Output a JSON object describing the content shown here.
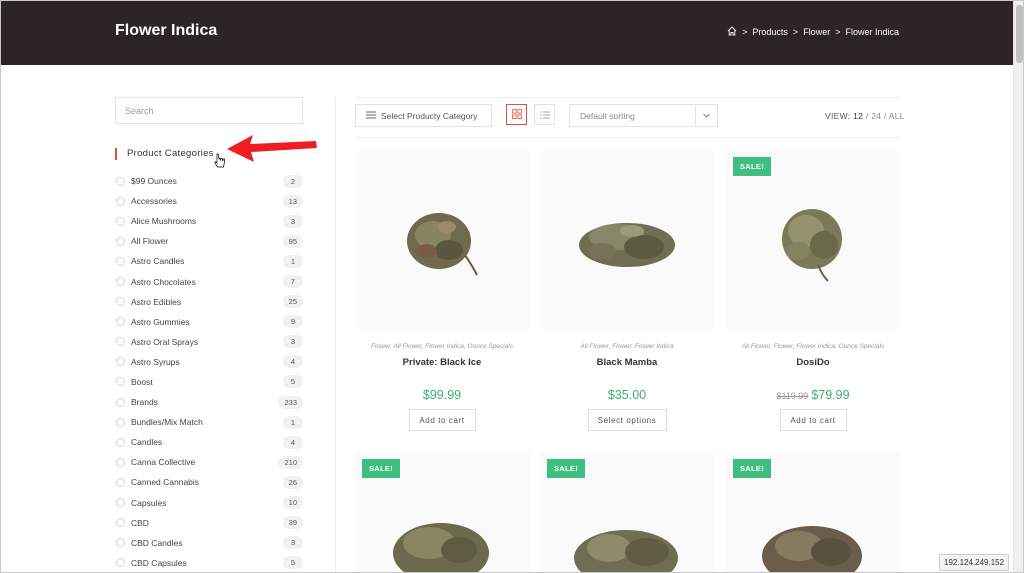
{
  "header": {
    "title": "Flower Indica",
    "breadcrumb": [
      "Products",
      "Flower",
      "Flower Indica"
    ],
    "separator": ">"
  },
  "sidebar": {
    "search_placeholder": "Search",
    "heading": "Product Categories",
    "categories": [
      {
        "name": "$99 Ounces",
        "count": "2"
      },
      {
        "name": "Accessories",
        "count": "13"
      },
      {
        "name": "Alice Mushrooms",
        "count": "3"
      },
      {
        "name": "All Flower",
        "count": "95"
      },
      {
        "name": "Astro Candles",
        "count": "1"
      },
      {
        "name": "Astro Chocolates",
        "count": "7"
      },
      {
        "name": "Astro Edibles",
        "count": "25"
      },
      {
        "name": "Astro Gummies",
        "count": "9"
      },
      {
        "name": "Astro Oral Sprays",
        "count": "3"
      },
      {
        "name": "Astro Syrups",
        "count": "4"
      },
      {
        "name": "Boost",
        "count": "5"
      },
      {
        "name": "Brands",
        "count": "233"
      },
      {
        "name": "Bundles/Mix Match",
        "count": "1"
      },
      {
        "name": "Candles",
        "count": "4"
      },
      {
        "name": "Canna Collective",
        "count": "210"
      },
      {
        "name": "Canned Cannabis",
        "count": "26"
      },
      {
        "name": "Capsules",
        "count": "10"
      },
      {
        "name": "CBD",
        "count": "39"
      },
      {
        "name": "CBD Candles",
        "count": "3"
      },
      {
        "name": "CBD Capsules",
        "count": "5"
      }
    ]
  },
  "toolbar": {
    "category_button": "Select Producty Category",
    "sort_value": "Default sorting",
    "view_label": "VIEW:",
    "view_current": "12",
    "view_sep": "/",
    "view_opt1": "24",
    "view_opt2": "ALL"
  },
  "products": [
    {
      "name": "Private: Black Ice",
      "categories": "Flower, All Flower, Flower Indica, Ounce Specials",
      "price": "$99.99",
      "old_price": "",
      "button": "Add to cart",
      "sale": ""
    },
    {
      "name": "Black Mamba",
      "categories": "All Flower, Flower, Flower Indica",
      "price": "$35.00",
      "old_price": "",
      "button": "Select options",
      "sale": ""
    },
    {
      "name": "DosiDo",
      "categories": "All Flower, Flower, Flower Indica, Ounce Specials",
      "price": "$79.99",
      "old_price": "$119.99",
      "button": "Add to cart",
      "sale": "SALE!"
    }
  ],
  "row2_sale": [
    "SALE!",
    "SALE!",
    "SALE!"
  ],
  "status": {
    "ip": "192.124.249.152"
  },
  "colors": {
    "accent": "#e84e3c",
    "sale": "#3fbf7f",
    "price": "#3dae6e",
    "header_bg": "#2d2524"
  },
  "icons": {
    "home": "home-icon",
    "menu": "menu-icon",
    "grid": "grid-view-icon",
    "list": "list-view-icon",
    "dropdown": "chevron-down-icon"
  }
}
